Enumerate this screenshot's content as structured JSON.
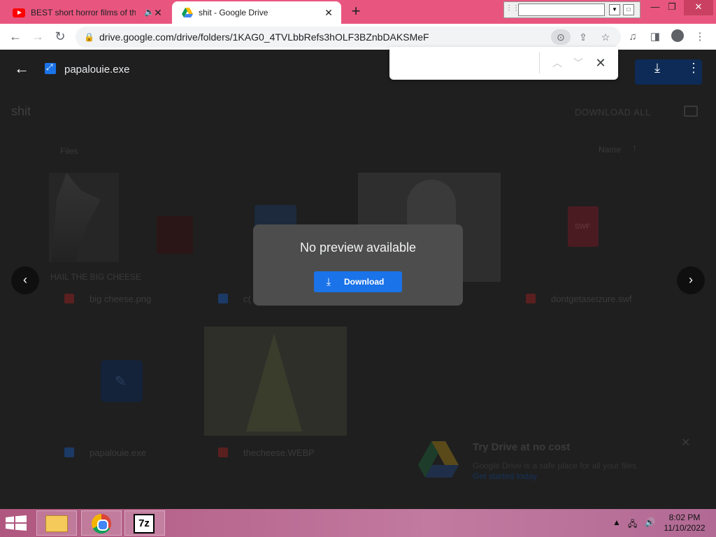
{
  "browser": {
    "tabs": [
      {
        "title": "BEST short horror films of th",
        "icon": "youtube-icon",
        "audio": "mute-icon"
      },
      {
        "title": "shit - Google Drive",
        "icon": "google-drive-icon"
      }
    ],
    "new_tab_label": "+",
    "url": "drive.google.com/drive/folders/1KAG0_4TVLbbRefs3hOLF3BZnbDAKSMeF"
  },
  "findbar": {
    "value": ""
  },
  "viewer": {
    "file_name": "papalouie.exe",
    "dialog_title": "No preview available",
    "download_label": "Download"
  },
  "background": {
    "folder_name": "shit",
    "download_all": "DOWNLOAD ALL",
    "files_label": "Files",
    "sort_label": "Name",
    "thumb_text": "HAIL THE BIG CHEESE",
    "files": [
      {
        "name": "big cheese.png"
      },
      {
        "name": "c("
      },
      {
        "name": "dontgetaseizure.swf"
      },
      {
        "name": "papalouie.exe"
      },
      {
        "name": "thecheese.WEBP"
      }
    ],
    "swf_badge": "SWF"
  },
  "promo": {
    "title": "Try Drive at no cost",
    "body": "Google Drive is a safe place for all your files",
    "link": "Get started today"
  },
  "taskbar": {
    "time": "8:02 PM",
    "date": "11/10/2022"
  },
  "colors": {
    "accent": "#1a73e8",
    "tabstrip": "#e8567f",
    "dialog": "#4d4d4d"
  }
}
